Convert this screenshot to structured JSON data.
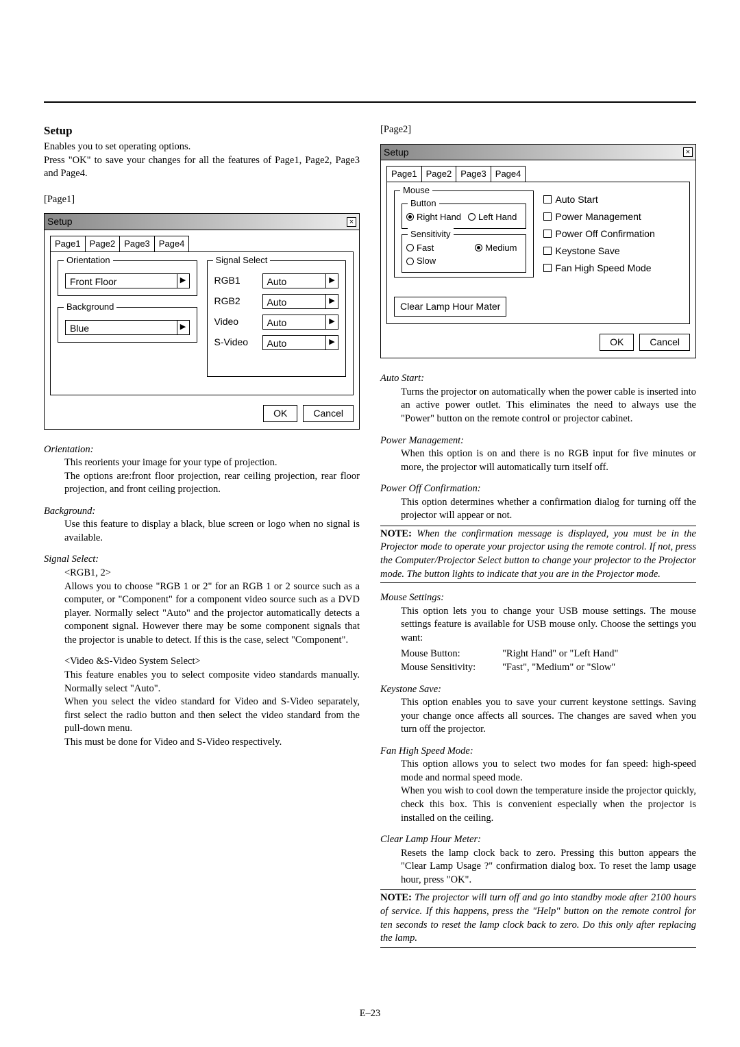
{
  "header": {
    "title": "Setup",
    "intro1": "Enables you to set operating options.",
    "intro2": "Press \"OK\" to save your changes for all the features of Page1, Page2, Page3 and Page4."
  },
  "page1": {
    "bracket": "[Page1]",
    "dialog": {
      "title": "Setup",
      "close": "×",
      "tabs": [
        "Page1",
        "Page2",
        "Page3",
        "Page4"
      ],
      "orientation": {
        "legend": "Orientation",
        "value": "Front Floor"
      },
      "background": {
        "legend": "Background",
        "value": "Blue"
      },
      "signal": {
        "legend": "Signal Select",
        "rows": [
          {
            "label": "RGB1",
            "value": "Auto"
          },
          {
            "label": "RGB2",
            "value": "Auto"
          },
          {
            "label": "Video",
            "value": "Auto"
          },
          {
            "label": "S-Video",
            "value": "Auto"
          }
        ]
      },
      "ok": "OK",
      "cancel": "Cancel"
    },
    "orientation": {
      "h": "Orientation:",
      "p1": "This reorients your image for your type of projection.",
      "p2": "The options are:front floor projection, rear ceiling projection, rear floor projection, and front ceiling projection."
    },
    "background": {
      "h": "Background:",
      "p": "Use this feature to display a black, blue screen or logo when no signal is available."
    },
    "signal": {
      "h": "Signal Select:",
      "sub1": "<RGB1, 2>",
      "p1": "Allows you to choose \"RGB 1 or 2\" for an RGB 1 or 2 source such as a computer, or \"Component\" for a component video source such as a DVD player. Normally select \"Auto\" and the projector automatically detects a component signal. However there may be some component signals that the projector is unable to detect. If this is the case, select \"Component\".",
      "sub2": "<Video &S-Video System Select>",
      "p2": "This feature enables you to select composite video standards manually. Normally select \"Auto\".",
      "p3": "When you select the video standard for Video and S-Video separately, first select the radio button and then select the video standard from the pull-down menu.",
      "p4": "This must be done for Video and S-Video respectively."
    }
  },
  "page2": {
    "bracket": "[Page2]",
    "dialog": {
      "title": "Setup",
      "close": "×",
      "tabs": [
        "Page1",
        "Page2",
        "Page3",
        "Page4"
      ],
      "mouse": {
        "legend": "Mouse",
        "button_legend": "Button",
        "sensitivity_legend": "Sensitivity",
        "button": {
          "right": "Right Hand",
          "left": "Left Hand",
          "selected": "right"
        },
        "sensitivity": {
          "fast": "Fast",
          "medium": "Medium",
          "slow": "Slow",
          "selected": "medium"
        }
      },
      "clear_lamp": "Clear Lamp Hour Mater",
      "checks": {
        "auto_start": "Auto Start",
        "power_management": "Power Management",
        "power_off_confirmation": "Power Off Confirmation",
        "keystone_save": "Keystone Save",
        "fan_high_speed": "Fan High Speed Mode"
      },
      "ok": "OK",
      "cancel": "Cancel"
    },
    "auto_start": {
      "h": "Auto Start:",
      "p": "Turns the projector on automatically when the power cable is inserted into an active power outlet. This eliminates the need to always use the \"Power\" button on the remote control or projector cabinet."
    },
    "power_management": {
      "h": "Power Management:",
      "p": "When this option is on and there is no RGB input for five minutes or more, the projector will automatically turn itself off."
    },
    "power_off": {
      "h": "Power Off Confirmation:",
      "p": "This option determines whether a confirmation dialog for turning off the projector will appear or not.",
      "note_strong": "NOTE:",
      "note": " When the confirmation message is displayed, you must be in the Projector mode to operate your projector using the remote control. If not, press the Computer/Projector Select button to change your projector to the Projector mode. The button lights to indicate that you are in the Projector mode."
    },
    "mouse_settings": {
      "h": "Mouse Settings:",
      "p": "This option lets you to change your USB mouse settings. The mouse settings feature is available for USB mouse only. Choose the settings you want:",
      "kv1": {
        "k": "Mouse Button:",
        "v": "\"Right Hand\" or \"Left Hand\""
      },
      "kv2": {
        "k": "Mouse Sensitivity:",
        "v": "\"Fast\", \"Medium\" or \"Slow\""
      }
    },
    "keystone_save": {
      "h": "Keystone Save:",
      "p": "This option enables you to save your current keystone settings. Saving your change once affects all sources. The changes are saved when you turn off the projector."
    },
    "fan_high_speed": {
      "h": "Fan High Speed Mode:",
      "p1": "This option allows you to select two modes for fan speed: high-speed mode and normal speed mode.",
      "p2": "When you wish to cool down the temperature inside the projector quickly, check this box. This is convenient especially when the projector is installed on the ceiling."
    },
    "clear_lamp": {
      "h": "Clear Lamp Hour Meter:",
      "p": "Resets the lamp clock back to zero. Pressing this button appears the \"Clear Lamp Usage ?\" confirmation dialog box. To reset the lamp usage hour, press \"OK\".",
      "note_strong": "NOTE:",
      "note": " The projector will turn off and go into standby mode after 2100 hours of service. If this happens, press the \"Help\" button on the remote control for ten seconds to reset the lamp clock back to zero. Do this only after replacing the lamp."
    }
  },
  "footer": "E–23"
}
